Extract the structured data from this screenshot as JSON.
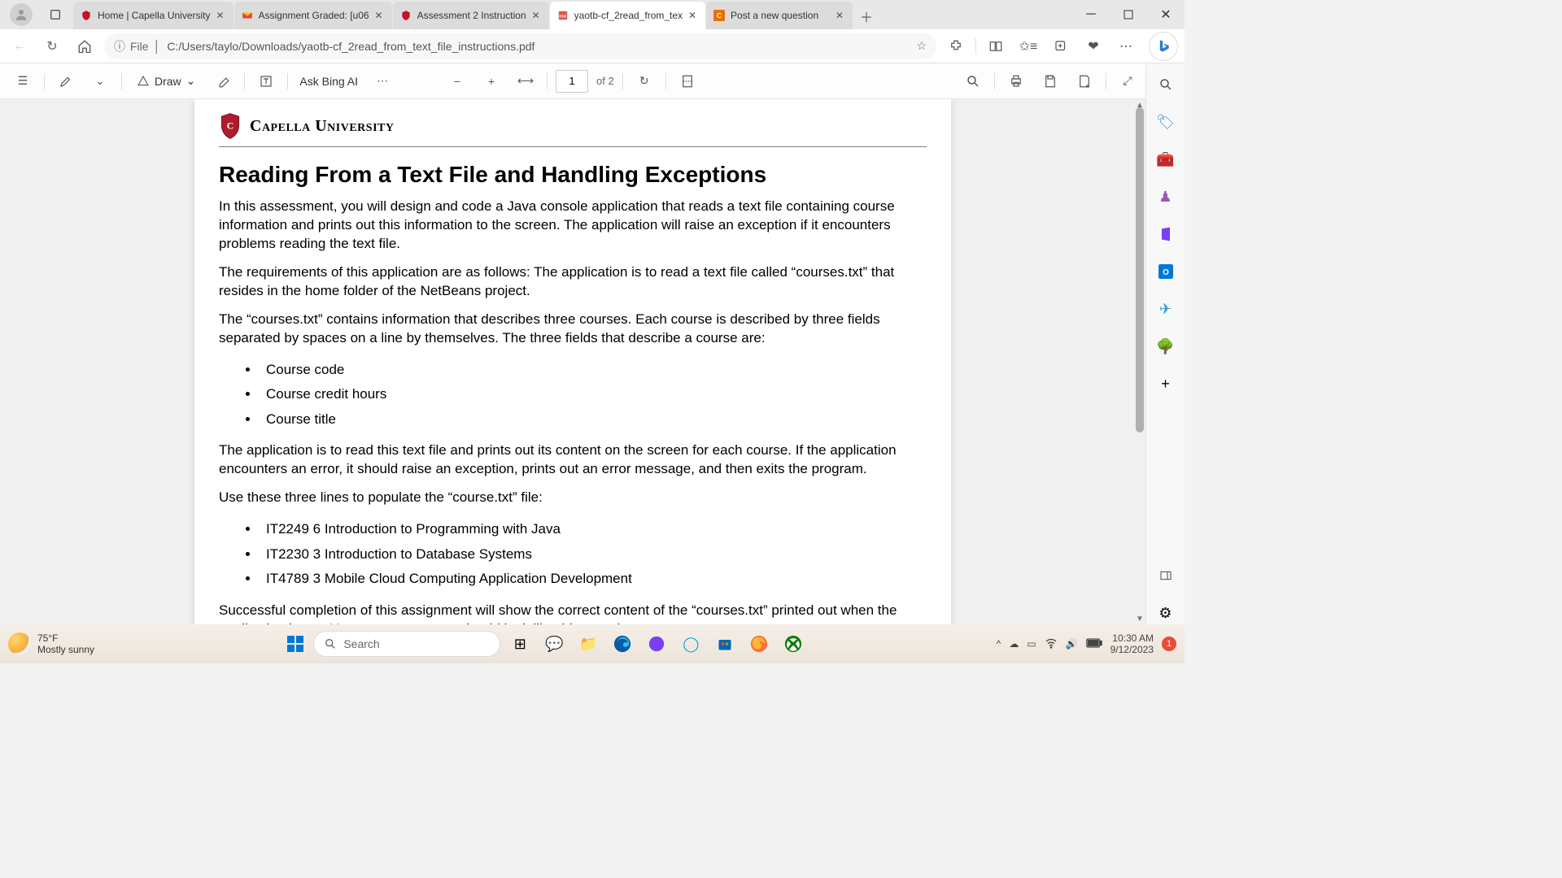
{
  "tabs": [
    {
      "title": "Home | Capella University",
      "favicon": "capella"
    },
    {
      "title": "Assignment Graded: [u06",
      "favicon": "gmail"
    },
    {
      "title": "Assessment 2 Instruction",
      "favicon": "capella"
    },
    {
      "title": "yaotb-cf_2read_from_tex",
      "favicon": "pdf",
      "active": true
    },
    {
      "title": "Post a new question",
      "favicon": "chegg"
    }
  ],
  "url": {
    "scheme_label": "File",
    "path": "C:/Users/taylo/Downloads/yaotb-cf_2read_from_text_file_instructions.pdf"
  },
  "pdf_toolbar": {
    "draw_label": "Draw",
    "ask_label": "Ask Bing AI",
    "page_current": "1",
    "page_total": "of 2"
  },
  "document": {
    "university": "Capella University",
    "title": "Reading From a Text File and Handling Exceptions",
    "p1": "In this assessment, you will design and code a Java console application that reads a text file containing course information and prints out this information to the screen. The application will raise an exception if it encounters problems reading the text file.",
    "p2": "The requirements of this application are as follows: The application is to read a text file called “courses.txt” that resides in the home folder of the NetBeans project.",
    "p3": "The “courses.txt” contains information that describes three courses. Each course is described by three fields separated by spaces on a line by themselves. The three fields that describe a course are:",
    "fields": [
      "Course code",
      "Course credit hours",
      "Course title"
    ],
    "p4": "The application is to read this text file and prints out its content on the screen for each course. If the application encounters an error, it should raise an exception, prints out an error message, and then exits the program.",
    "p5": "Use these three lines to populate the “course.txt” file:",
    "lines": [
      "IT2249 6 Introduction to Programming with Java",
      "IT2230 3 Introduction to Database Systems",
      "IT4789 3 Mobile Cloud Computing Application Development"
    ],
    "p6": "Successful completion of this assignment will show the correct content of the “courses.txt” printed out when the application is run. Your program output should look like this sample output:"
  },
  "taskbar": {
    "weather_temp": "75°F",
    "weather_desc": "Mostly sunny",
    "search_placeholder": "Search",
    "time": "10:30 AM",
    "date": "9/12/2023",
    "notif_count": "1"
  }
}
